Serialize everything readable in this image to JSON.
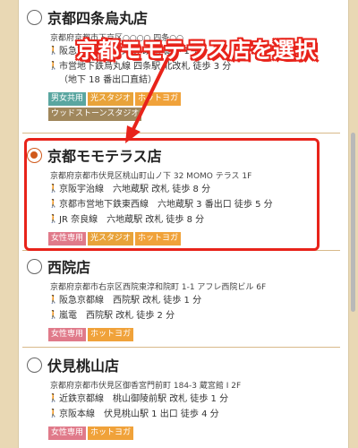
{
  "callout": {
    "text": "京都モモテラス店を選択"
  },
  "colors": {
    "accent": "#d05a1c",
    "highlight": "#e8231a",
    "walk_icon": "#e08a00"
  },
  "tag_colors": {
    "男女共用": "#5aa6a0",
    "光スタジオ": "#e8a33a",
    "ホットヨガ": "#f0a23a",
    "ウッドストーンスタジオ": "#a0875c",
    "女性専用": "#e07a8a"
  },
  "stores": [
    {
      "name": "京都四条烏丸店",
      "selected": false,
      "address": "京都府京都市下京区○○○○ 四条○○",
      "access": [
        "阪急京都線　烏丸駅 改札 徒歩 1 分",
        "市営地下鉄烏丸線 四条駅 北改札 徒歩 3 分\n（地下 18 番出口直結）"
      ],
      "tags": [
        "男女共用",
        "光スタジオ",
        "ホットヨガ",
        "ウッドストーンスタジオ"
      ]
    },
    {
      "name": "京都モモテラス店",
      "selected": true,
      "address": "京都府京都市伏見区桃山町山ノ下 32 MOMO テラス 1F",
      "access": [
        "京阪宇治線　六地蔵駅 改札 徒歩 8 分",
        "京都市営地下鉄東西線　六地蔵駅 3 番出口 徒歩 5 分",
        "JR 奈良線　六地蔵駅 改札 徒歩 8 分"
      ],
      "tags": [
        "女性専用",
        "光スタジオ",
        "ホットヨガ"
      ]
    },
    {
      "name": "西院店",
      "selected": false,
      "address": "京都府京都市右京区西院東淳和院町 1-1 アフレ西院ビル 6F",
      "access": [
        "阪急京都線　西院駅 改札 徒歩 1 分",
        "嵐電　西院駅 改札 徒歩 2 分"
      ],
      "tags": [
        "女性専用",
        "ホットヨガ"
      ]
    },
    {
      "name": "伏見桃山店",
      "selected": false,
      "address": "京都府京都市伏見区御香宮門前町 184-3 蔵宮館 I 2F",
      "access": [
        "近鉄京都線　桃山御陵前駅 改札 徒歩 1 分",
        "京阪本線　伏見桃山駅 1 出口 徒歩 4 分"
      ],
      "tags": [
        "女性専用",
        "ホットヨガ"
      ]
    }
  ]
}
